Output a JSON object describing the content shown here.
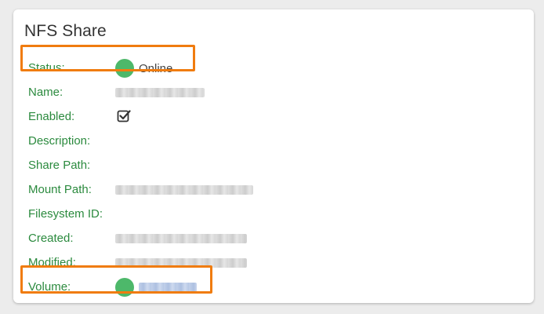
{
  "panel": {
    "title": "NFS Share"
  },
  "fields": {
    "status": {
      "label": "Status:",
      "value": "Online",
      "indicator": "green-status-dot"
    },
    "name": {
      "label": "Name:",
      "value_redacted": true
    },
    "enabled": {
      "label": "Enabled:",
      "value": "checked",
      "icon": "checkbox-checked-icon"
    },
    "description": {
      "label": "Description:",
      "value": ""
    },
    "share_path": {
      "label": "Share Path:",
      "value": ""
    },
    "mount_path": {
      "label": "Mount Path:",
      "value_redacted": true
    },
    "filesystem_id": {
      "label": "Filesystem ID:",
      "value": ""
    },
    "created": {
      "label": "Created:",
      "value_redacted": true
    },
    "modified": {
      "label": "Modified:",
      "value_redacted": true
    },
    "volume": {
      "label": "Volume:",
      "value_redacted": true,
      "indicator": "green-status-dot",
      "is_link": true
    }
  },
  "colors": {
    "label_green": "#2b8a3e",
    "status_green": "#4db86a",
    "highlight_orange": "#f07c0f",
    "link_blue": "#3b6bc4"
  }
}
